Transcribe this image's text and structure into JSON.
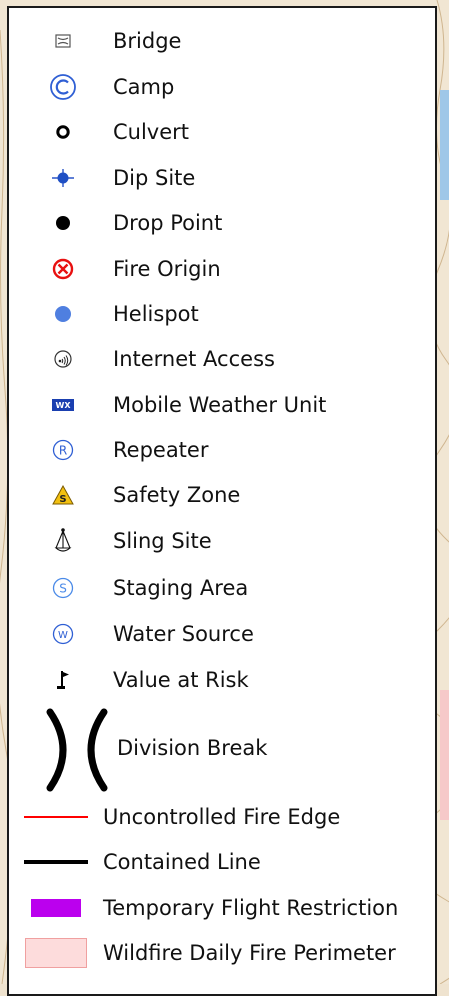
{
  "legend": {
    "items": [
      {
        "label": "Bridge",
        "icon": "bridge-icon"
      },
      {
        "label": "Camp",
        "icon": "camp-icon"
      },
      {
        "label": "Culvert",
        "icon": "culvert-icon"
      },
      {
        "label": "Dip Site",
        "icon": "dip-site-icon"
      },
      {
        "label": "Drop Point",
        "icon": "drop-point-icon"
      },
      {
        "label": "Fire Origin",
        "icon": "fire-origin-icon"
      },
      {
        "label": "Helispot",
        "icon": "helispot-icon"
      },
      {
        "label": "Internet Access",
        "icon": "internet-access-icon"
      },
      {
        "label": "Mobile Weather Unit",
        "icon": "mobile-weather-unit-icon",
        "badge": "WX"
      },
      {
        "label": "Repeater",
        "icon": "repeater-icon",
        "glyph": "R"
      },
      {
        "label": "Safety Zone",
        "icon": "safety-zone-icon",
        "glyph": "S"
      },
      {
        "label": "Sling Site",
        "icon": "sling-site-icon"
      },
      {
        "label": "Staging Area",
        "icon": "staging-area-icon",
        "glyph": "S"
      },
      {
        "label": "Water Source",
        "icon": "water-source-icon",
        "glyph": "W"
      },
      {
        "label": "Value at Risk",
        "icon": "value-at-risk-icon"
      },
      {
        "label": "Division Break",
        "icon": "division-break-icon"
      },
      {
        "label": "Uncontrolled Fire Edge",
        "icon": "uncontrolled-fire-edge-line",
        "color": "#ff0000"
      },
      {
        "label": "Contained Line",
        "icon": "contained-line",
        "color": "#000000"
      },
      {
        "label": "Temporary Flight Restriction",
        "icon": "temporary-flight-restriction-swatch",
        "color": "#bb00ee"
      },
      {
        "label": "Wildfire Daily Fire Perimeter",
        "icon": "wildfire-daily-fire-perimeter-swatch",
        "color": "#fddcdc"
      }
    ]
  }
}
